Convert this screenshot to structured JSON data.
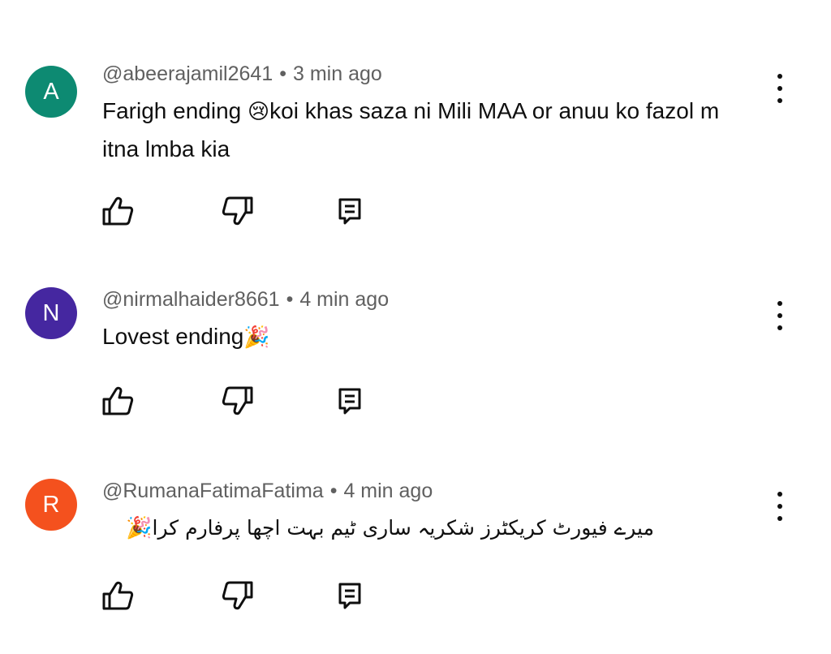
{
  "comments": [
    {
      "avatar_letter": "A",
      "avatar_color": "#0d8a72",
      "handle": "@abeerajamil2641",
      "separator": "•",
      "time": "3 min ago",
      "text_before_emoji": "Farigh ending ",
      "emoji": "😢",
      "text_after_emoji": "koi khas saza ni Mili MAA or anuu ko fazol m itna lmba kia",
      "menu_icon": "more-vert-icon"
    },
    {
      "avatar_letter": "N",
      "avatar_color": "#4527a0",
      "handle": "@nirmalhaider8661",
      "separator": "•",
      "time": "4 min ago",
      "text_before_emoji": "Lovest ending",
      "emoji": "🎉",
      "text_after_emoji": "",
      "menu_icon": "more-vert-icon"
    },
    {
      "avatar_letter": "R",
      "avatar_color": "#f4511e",
      "handle": "@RumanaFatimaFatima",
      "separator": "•",
      "time": "4 min ago",
      "text_before_emoji": "میرے فیورٹ کریکٹرز شکریہ ساری ٹیم بہت اچھا پرفارم کرا",
      "emoji": "🎉",
      "text_after_emoji": "",
      "menu_icon": "more-vert-icon"
    }
  ],
  "action_icons": [
    "like-icon",
    "dislike-icon",
    "reply-icon"
  ]
}
